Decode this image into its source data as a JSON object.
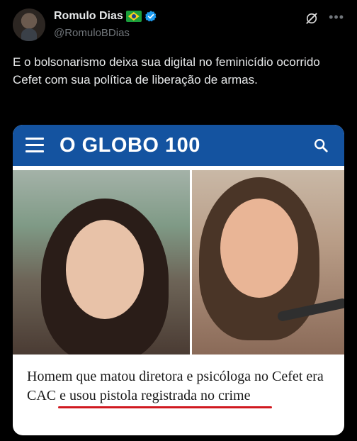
{
  "author": {
    "display_name": "Romulo Dias",
    "handle": "@RomuloBDias"
  },
  "tweet": {
    "text": "E o bolsonarismo deixa sua digital no feminicídio ocorrido Cefet com sua política de liberação de armas."
  },
  "card": {
    "brand": "O GLOBO 100",
    "headline": "Homem que matou diretora e psicóloga no Cefet era CAC e usou pistola registrada no crime"
  },
  "colors": {
    "globo_blue": "#1453a0",
    "verified_blue": "#1d9bf0",
    "underline_red": "#d0181f"
  },
  "icons": [
    "avatar",
    "brazil-flag-icon",
    "verified-badge-icon",
    "grok-icon",
    "more-icon",
    "menu-icon",
    "search-icon"
  ]
}
